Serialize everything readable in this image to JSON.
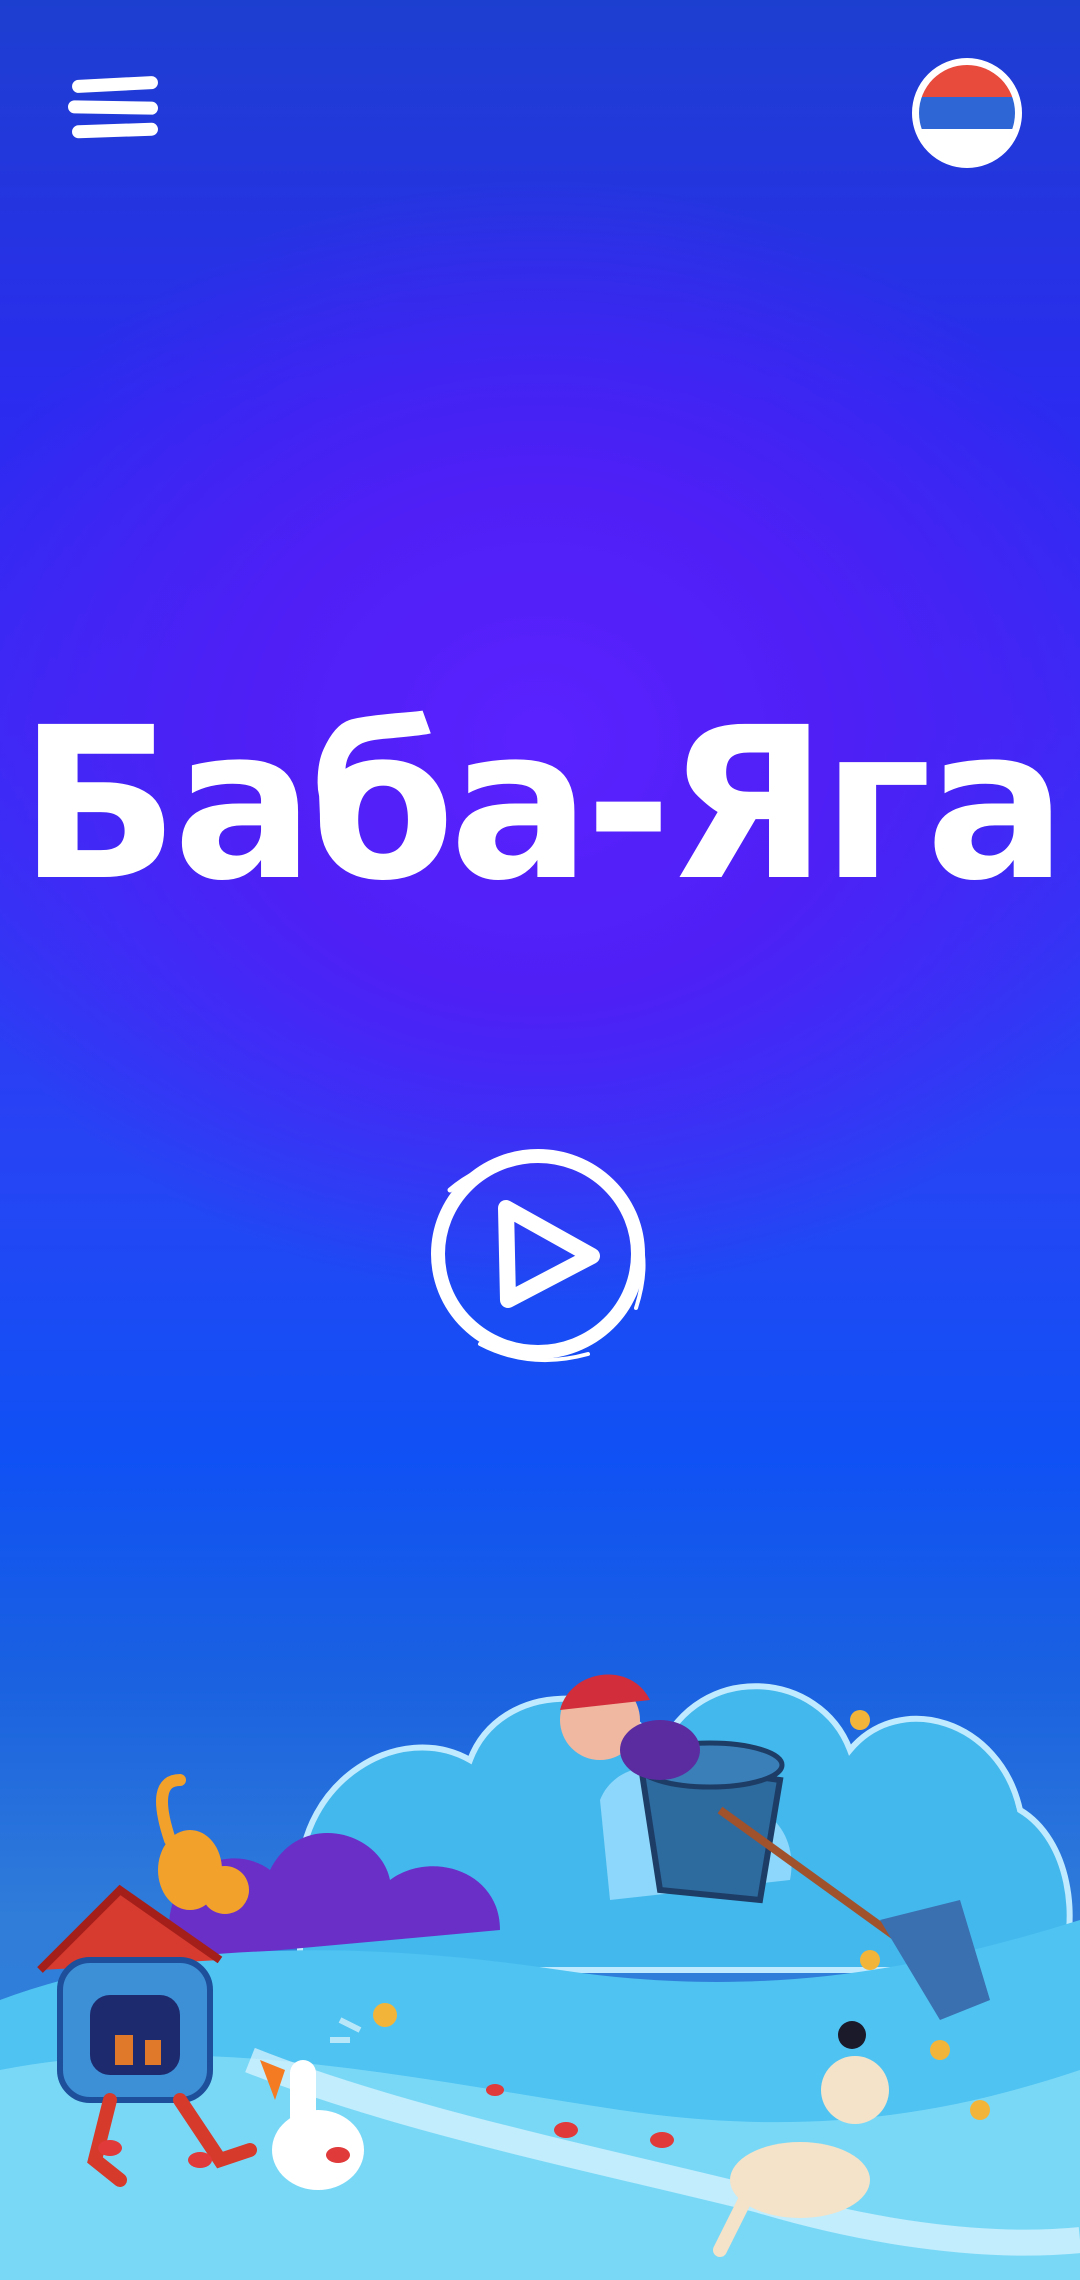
{
  "header": {
    "menu_icon": "hamburger-menu-icon",
    "language_flag": {
      "icon": "russia-flag-icon",
      "colors": [
        "#ffffff",
        "#2e66d6",
        "#e84a3c"
      ]
    }
  },
  "main": {
    "title": "Баба-Яга",
    "play_icon": "play-icon"
  },
  "scene": {
    "illustration": "baba-yaga-illustration"
  },
  "colors": {
    "background_top": "#1d3fd0",
    "background_center": "#5a22ff",
    "background_bottom": "#2f86d8",
    "text": "#ffffff"
  }
}
